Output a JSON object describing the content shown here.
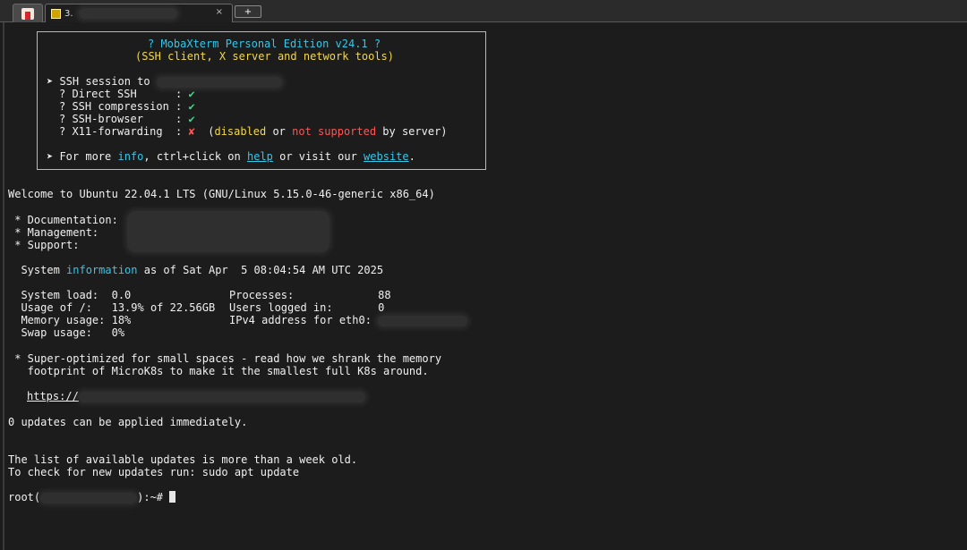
{
  "tabbar": {
    "session_tab_label": "3.",
    "close_glyph": "×",
    "new_tab_glyph": "+"
  },
  "banner": {
    "title": "? MobaXterm Personal Edition v24.1 ?",
    "subtitle": "(SSH client, X server and network tools)",
    "ssh_session": "➤ SSH session to",
    "features": [
      {
        "label": "? Direct SSH      :",
        "status": "✔"
      },
      {
        "label": "? SSH compression :",
        "status": "✔"
      },
      {
        "label": "? SSH-browser     :",
        "status": "✔"
      },
      {
        "label": "? X11-forwarding  :",
        "status": "✘"
      }
    ],
    "x11_note": {
      "open": "(",
      "disabled": "disabled",
      "or": " or ",
      "not_supported": "not supported",
      "tail": " by server)"
    },
    "more": {
      "prefix": "➤ For more ",
      "info": "info",
      "mid": ", ctrl+click on ",
      "help": "help",
      "mid2": " or visit our ",
      "website": "website",
      "end": "."
    }
  },
  "motd": {
    "welcome": "Welcome to Ubuntu 22.04.1 LTS (GNU/Linux 5.15.0-46-generic x86_64)",
    "links": [
      " * Documentation:",
      " * Management:",
      " * Support:"
    ],
    "sysinfo": {
      "prefix": "  System ",
      "information": "information",
      "suffix": " as of Sat Apr  5 08:04:54 AM UTC 2025"
    },
    "stats_left": [
      "  System load:  0.0",
      "  Usage of /:   13.9% of 22.56GB",
      "  Memory usage: 18%",
      "  Swap usage:   0%"
    ],
    "stats_right": [
      "Processes:             88",
      "Users logged in:       0",
      "IPv4 address for eth0:"
    ],
    "promo_1": " * Super-optimized for small spaces - read how we shrank the memory",
    "promo_2": "   footprint of MicroK8s to make it the smallest full K8s around.",
    "promo_link": "https://",
    "updates": "0 updates can be applied immediately.",
    "list_old": "The list of available updates is more than a week old.",
    "check_updates": "To check for new updates run: sudo apt update"
  },
  "prompt": {
    "user": "root(",
    "suffix": "):~# "
  }
}
